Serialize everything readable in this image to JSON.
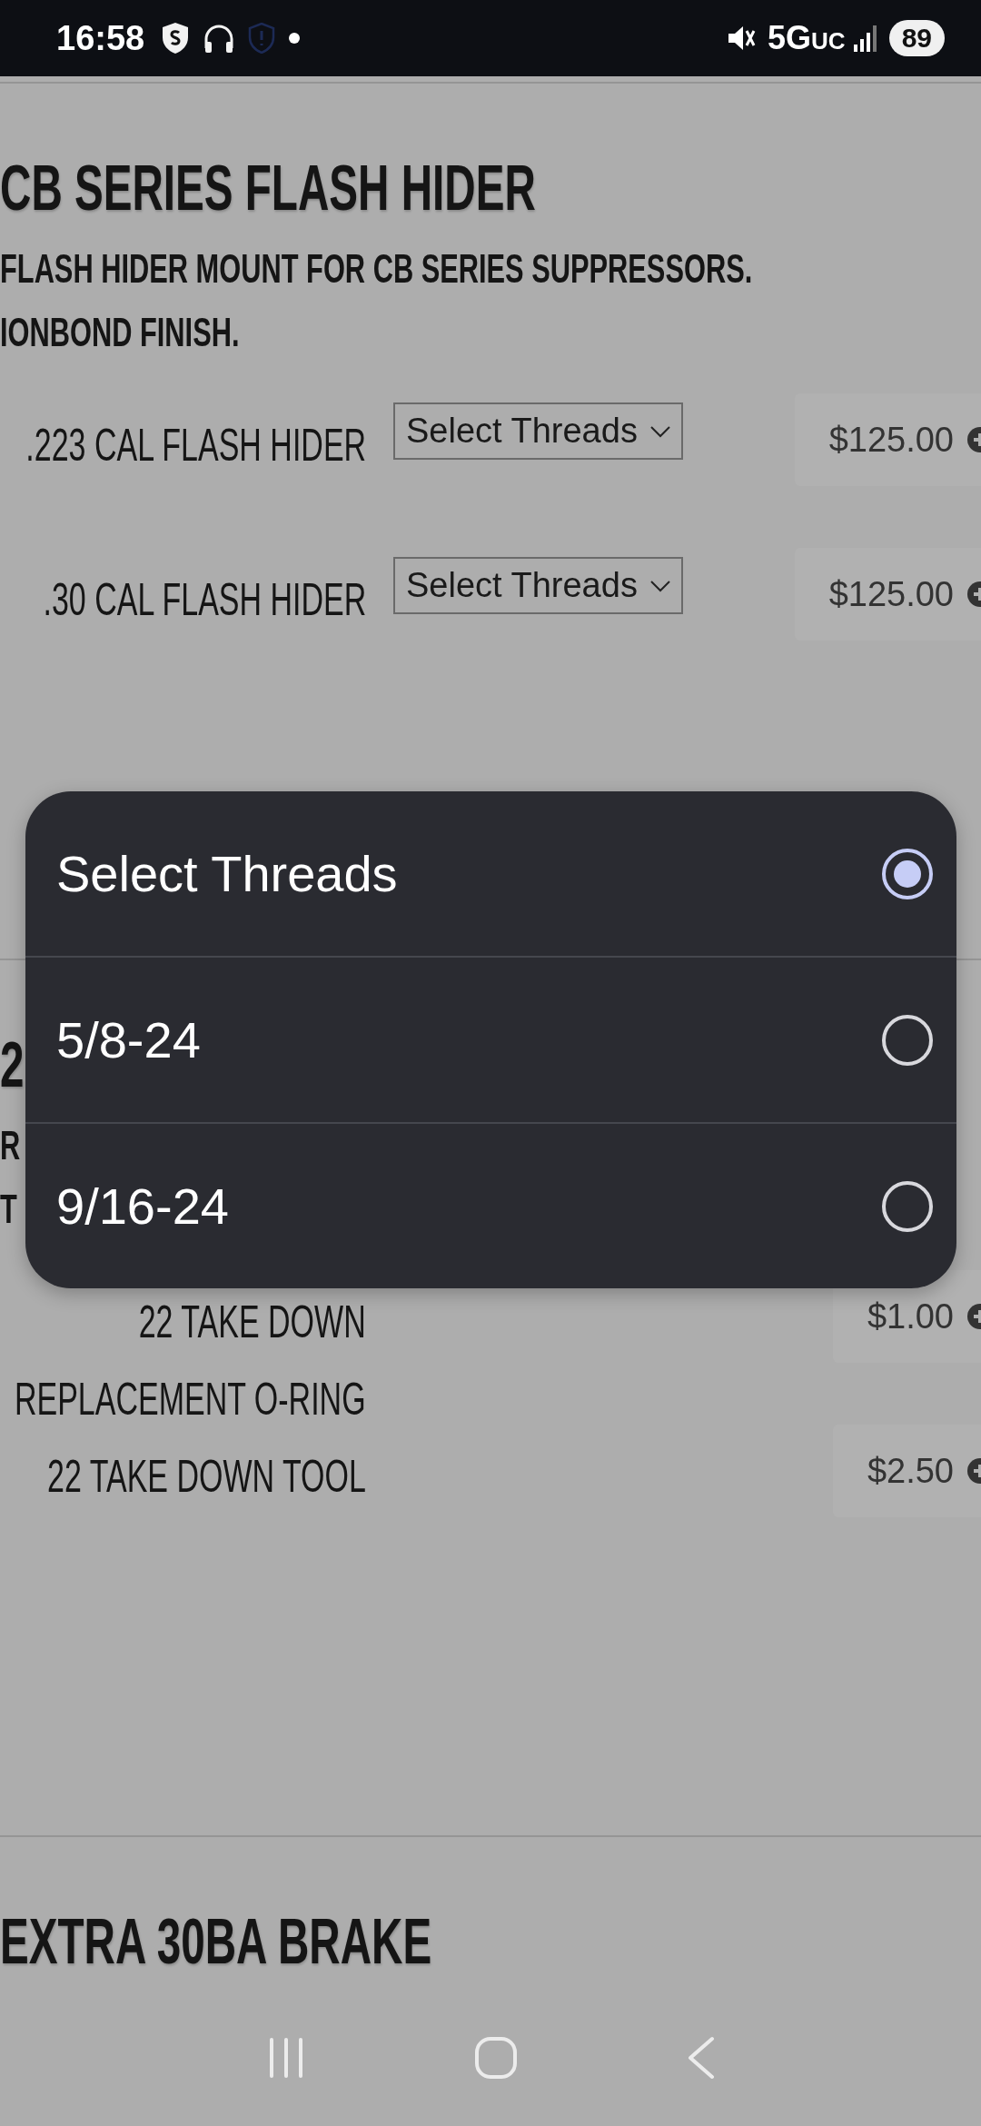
{
  "status_bar": {
    "time": "16:58",
    "network": "5G",
    "network_suffix": "UC",
    "battery": "89"
  },
  "sections": [
    {
      "title": "CB SERIES FLASH HIDER",
      "description": [
        "FLASH HIDER MOUNT FOR CB SERIES SUPPRESSORS.",
        "IONBOND FINISH."
      ],
      "products": [
        {
          "name": [
            ".223 CAL FLASH HIDER"
          ],
          "select": "Select Threads",
          "price": "$125.00"
        },
        {
          "name": [
            ".30 CAL FLASH HIDER"
          ],
          "select": "Select Threads",
          "price": "$125.00"
        }
      ]
    },
    {
      "title": "2",
      "description": [
        "R",
        "T"
      ],
      "products": [
        {
          "name": [
            "22 TAKE DOWN",
            "REPLACEMENT O-RING"
          ],
          "price": "$1.00"
        },
        {
          "name": [
            "22 TAKE DOWN TOOL"
          ],
          "price": "$2.50"
        }
      ]
    },
    {
      "title": "EXTRA 30BA BRAKE"
    }
  ],
  "dialog": {
    "options": [
      {
        "label": "Select Threads",
        "selected": true
      },
      {
        "label": "5/8-24",
        "selected": false
      },
      {
        "label": "9/16-24",
        "selected": false
      }
    ]
  }
}
